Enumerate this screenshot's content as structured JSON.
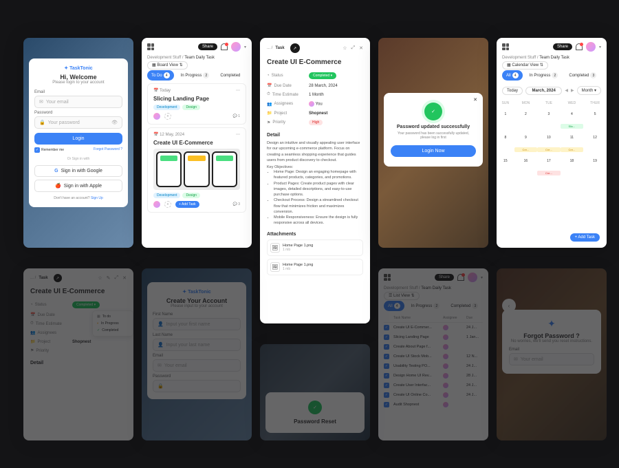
{
  "brand": "TaskTonic",
  "login": {
    "welcome": "Hi, Welcome",
    "subtitle": "Please login to your account",
    "email_label": "Email",
    "email_ph": "Your email",
    "password_label": "Password",
    "password_ph": "Your password",
    "login_btn": "Login",
    "remember": "Remember me",
    "forgot": "Forgot Password ?",
    "or_signin": "Or Sign in with",
    "google": "Sign in with Google",
    "apple": "Sign in with Apple",
    "no_account": "Don't have an account?",
    "signup": "Sign Up"
  },
  "board": {
    "share": "Share",
    "crumb1": "Development Stuff",
    "crumb2": "Team Daily Task",
    "view_label": "Board View",
    "tabs": {
      "todo": "To Do",
      "todo_n": "4",
      "inprog": "In Progress",
      "inprog_n": "2",
      "done": "Completed"
    },
    "card1": {
      "date": "Today",
      "title": "Slicing Landing Page",
      "tag1": "Development",
      "tag2": "Design",
      "comments": "1"
    },
    "card2": {
      "date": "12 May, 2024",
      "title": "Create UI E-Commerce",
      "tag1": "Development",
      "tag2": "Design",
      "add_task": "Add Task",
      "comments": "3"
    }
  },
  "task": {
    "crumb": "Task",
    "title": "Create UI E-Commerce",
    "status_k": "Status",
    "status_v": "Completed",
    "due_k": "Due Date",
    "due_v": "28 March, 2024",
    "time_k": "Time Estimate",
    "time_v": "1 Month",
    "assign_k": "Assignees",
    "assign_v": "You",
    "project_k": "Project",
    "project_v": "Shopnest",
    "priority_k": "Priority",
    "priority_v": "High",
    "detail_h": "Detail",
    "detail_body": "Design an intuitive and visually appealing user interface for our upcoming e-commerce platform. Focus on creating a seamless shopping experience that guides users from product discovery to checkout.",
    "objectives_h": "Key Objectives:",
    "obj1": "Home Page: Design an engaging homepage with featured products, categories, and promotions.",
    "obj2": "Product Pages: Create product pages with clear images, detailed descriptions, and easy-to-use purchase options.",
    "obj3": "Checkout Process: Design a streamlined checkout flow that minimizes friction and maximizes conversion.",
    "obj4": "Mobile Responsiveness: Ensure the design is fully responsive across all devices.",
    "attach_h": "Attachments",
    "att1_name": "Home Page 1.png",
    "att1_size": "1 mb",
    "att2_name": "Home Page 1.png",
    "att2_size": "1 mb"
  },
  "pwd": {
    "title": "Password updated successfully",
    "sub1": "Your password has been successfully updated,",
    "sub2": "please log in first",
    "btn": "Login Now"
  },
  "calendar": {
    "share": "Share",
    "crumb1": "Development Stuff",
    "crumb2": "Team Daily Task",
    "view_label": "Calendar View",
    "all": "All",
    "all_n": "4",
    "inprog": "In Progress",
    "inprog_n": "2",
    "done": "Completed",
    "done_n": "3",
    "today": "Today",
    "month": "March, 2024",
    "period": "Month",
    "days": [
      "SUN",
      "MON",
      "TUE",
      "WED",
      "THUR"
    ],
    "add_task": "Add Task"
  },
  "task2": {
    "crumb": "Task",
    "title": "Create UI E-Commerce",
    "status_k": "Status",
    "status_v": "Completed",
    "due": "Due Date",
    "time": "Time Estimate",
    "assign": "Assignees",
    "project_k": "Project",
    "project_v": "Shopnest",
    "priority": "Priority",
    "menu_todo": "To do",
    "menu_inprog": "In Progress",
    "menu_done": "Completed",
    "detail_h": "Detail"
  },
  "signup": {
    "title": "Create Your Account",
    "sub": "Please input to your account",
    "fn": "First Name",
    "fn_ph": "Input your first name",
    "ln": "Last Name",
    "ln_ph": "Input your last name",
    "em": "Email",
    "em_ph": "Your email",
    "pw": "Password"
  },
  "reset_title": "Password Reset",
  "list": {
    "share": "Share",
    "crumb1": "Development Stuff",
    "crumb2": "Team Daily Task",
    "view_label": "List View",
    "all": "All",
    "all_n": "4",
    "inprog": "In Progress",
    "inprog_n": "2",
    "done": "Completed",
    "done_n": "3",
    "col_name": "Task Name",
    "col_assign": "Assignee",
    "col_due": "Due",
    "r1": "Create UI E-Commer...",
    "d1": "24 J...",
    "r2": "Slicing Landing Page",
    "d2": "1 Jan...",
    "r3": "Create About Page f...",
    "r4": "Create UI Stock Mob...",
    "d4": "12 N...",
    "r5": "Usability Testing PO...",
    "d5": "24 J...",
    "r6": "Design Home UI Rev...",
    "d6": "28 J...",
    "r7": "Create User Interfac...",
    "d7": "24 J...",
    "r8": "Create UI Online Co...",
    "d8": "24 J...",
    "r9": "Audit Shopnest"
  },
  "forgot": {
    "title": "Forgot Password ?",
    "sub": "No worries, we'll send you reset instructions.",
    "em": "Email",
    "ph": "Your email"
  }
}
